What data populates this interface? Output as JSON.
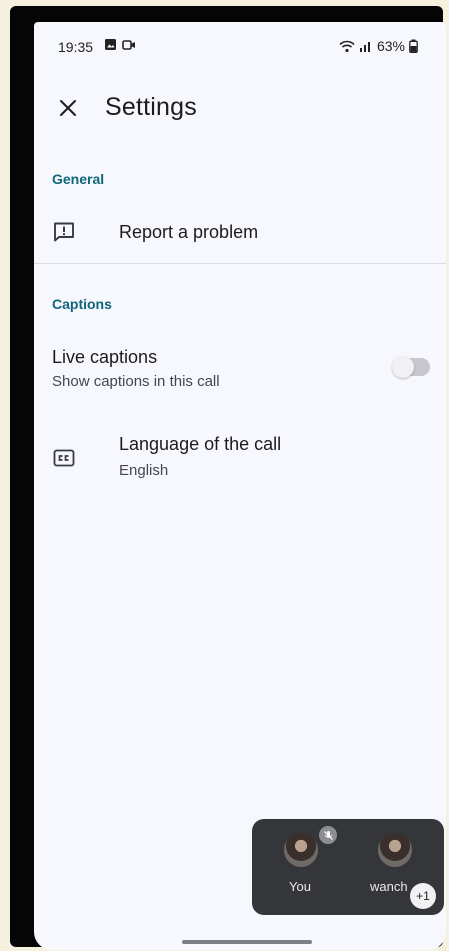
{
  "status_bar": {
    "time": "19:35",
    "battery": "63%"
  },
  "app_bar": {
    "title": "Settings",
    "close_icon": "close-icon"
  },
  "sections": {
    "general": {
      "header": "General",
      "report": {
        "label": "Report a problem",
        "icon": "feedback-icon"
      }
    },
    "captions": {
      "header": "Captions",
      "live": {
        "title": "Live captions",
        "subtitle": "Show captions in this call",
        "enabled": false
      },
      "language": {
        "title": "Language of the call",
        "value": "English",
        "icon": "closed-caption-icon"
      }
    }
  },
  "pip": {
    "participants": [
      {
        "name": "You",
        "muted": true
      },
      {
        "name": "wanch"
      }
    ],
    "extra_count": "+1"
  },
  "colors": {
    "accent": "#0f6778",
    "background": "#f7f8fe",
    "pip": "#353639"
  }
}
